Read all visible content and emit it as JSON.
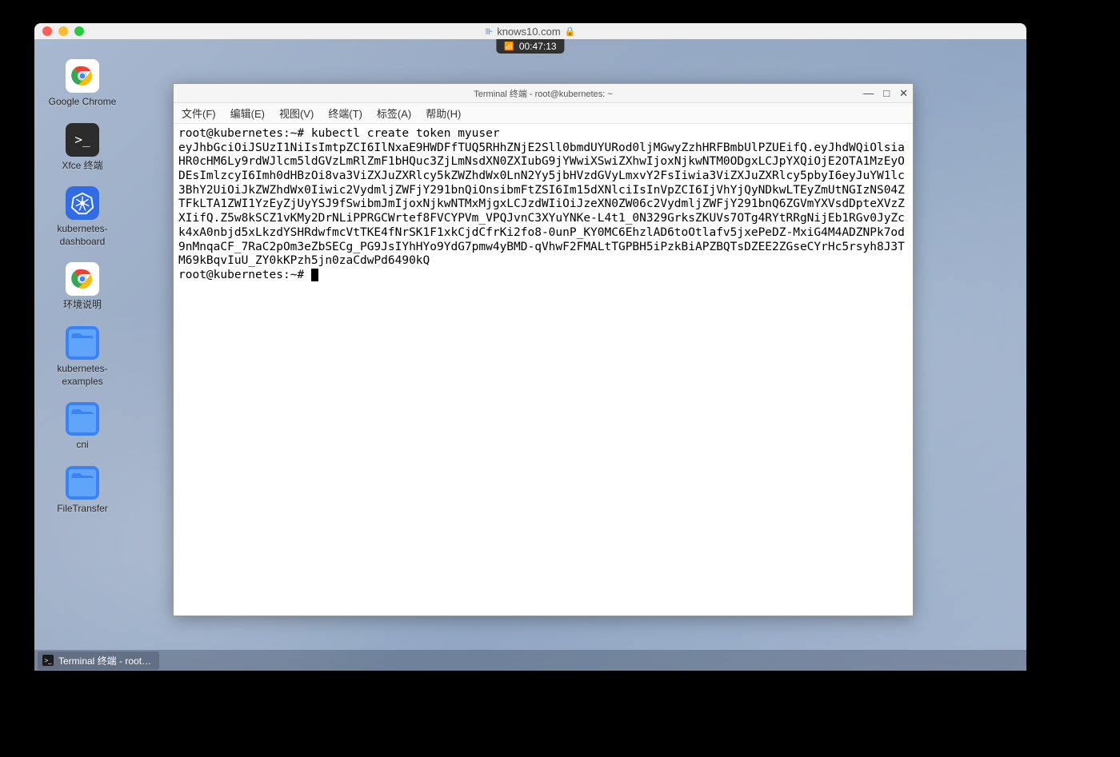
{
  "browser": {
    "url": "knows10.com"
  },
  "timer": "00:47:13",
  "desktop_icons": [
    {
      "label": "Google Chrome"
    },
    {
      "label": "Xfce 终端"
    },
    {
      "label": "kubernetes-dashboard"
    },
    {
      "label": "环境说明"
    },
    {
      "label": "kubernetes-examples"
    },
    {
      "label": "cni"
    },
    {
      "label": "FileTransfer"
    }
  ],
  "terminal": {
    "title": "Terminal 终端 - root@kubernetes: ~",
    "menu": {
      "file": "文件(F)",
      "edit": "编辑(E)",
      "view": "视图(V)",
      "terminal": "终端(T)",
      "tabs": "标签(A)",
      "help": "帮助(H)"
    },
    "prompt1": "root@kubernetes:~# ",
    "command": "kubectl create token myuser",
    "output": "eyJhbGciOiJSUzI1NiIsImtpZCI6IlNxaE9HWDFfTUQ5RHhZNjE2Sll0bmdUYURod0ljMGwyZzhHRFBmbUlPZUEifQ.eyJhdWQiOlsiaHR0cHM6Ly9rdWJlcm5ldGVzLmRlZmF1bHQuc3ZjLmNsdXN0ZXIubG9jYWwiXSwiZXhwIjoxNjkwNTM0ODgxLCJpYXQiOjE2OTA1MzEyODEsImlzcyI6Imh0dHBzOi8va3ViZXJuZXRlcy5kZWZhdWx0LnN2Yy5jbHVzdGVyLmxvY2FsIiwia3ViZXJuZXRlcy5pbyI6eyJuYW1lc3BhY2UiOiJkZWZhdWx0Iiwic2VydmljZWFjY291bnQiOnsibmFtZSI6Im15dXNlciIsInVpZCI6IjVhYjQyNDkwLTEyZmUtNGIzNS04ZTFkLTA1ZWI1YzEyZjUyYSJ9fSwibmJmIjoxNjkwNTMxMjgxLCJzdWIiOiJzeXN0ZW06c2VydmljZWFjY291bnQ6ZGVmYXVsdDpteXVzZXIifQ.Z5w8kSCZ1vKMy2DrNLiPPRGCWrtef8FVCYPVm_VPQJvnC3XYuYNKe-L4t1_0N329GrksZKUVs7OTg4RYtRRgNijEb1RGv0JyZck4xA0nbjd5xLkzdYSHRdwfmcVtTKE4fNrSK1F1xkCjdCfrKi2fo8-0unP_KY0MC6EhzlAD6toOtlafv5jxePeDZ-MxiG4M4ADZNPk7od9nMnqaCF_7RaC2pOm3eZbSECg_PG9JsIYhHYo9YdG7pmw4yBMD-qVhwF2FMALtTGPBH5iPzkBiAPZBQTsDZEE2ZGseCYrHc5rsyh8J3TM69kBqvIuU_ZY0kKPzh5jn0zaCdwPd6490kQ",
    "prompt2": "root@kubernetes:~# "
  },
  "taskbar": {
    "item1": "Terminal 终端 - root…"
  }
}
